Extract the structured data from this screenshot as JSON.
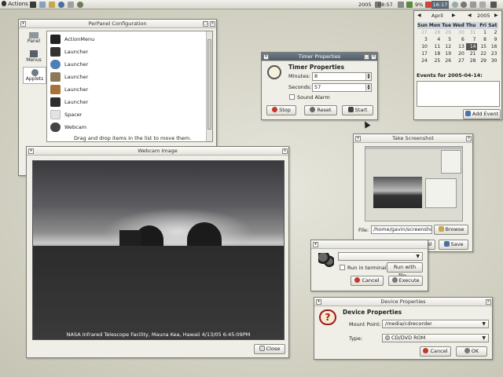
{
  "panel": {
    "menu_label": "Actions",
    "year": "2005",
    "time_small": "08:57",
    "battery": "9%",
    "clock": "16:17"
  },
  "calendar": {
    "month": "April",
    "year": "2005",
    "weekdays": [
      "Sun",
      "Mon",
      "Tue",
      "Wed",
      "Thu",
      "Fri",
      "Sat"
    ],
    "weeks": [
      [
        "27",
        "28",
        "29",
        "30",
        "31",
        "1",
        "2"
      ],
      [
        "3",
        "4",
        "5",
        "6",
        "7",
        "8",
        "9"
      ],
      [
        "10",
        "11",
        "12",
        "13",
        "14",
        "15",
        "16"
      ],
      [
        "17",
        "18",
        "19",
        "20",
        "21",
        "22",
        "23"
      ],
      [
        "24",
        "25",
        "26",
        "27",
        "28",
        "29",
        "30"
      ]
    ],
    "selected_day": "14",
    "events_label": "Events for 2005-04-14:",
    "add_event": "Add Event"
  },
  "perpanel": {
    "title": "PerPanel Configuration",
    "side_tabs": [
      "Panel",
      "Menus",
      "Applets"
    ],
    "items": [
      "ActionMenu",
      "Launcher",
      "Launcher",
      "Launcher",
      "Launcher",
      "Launcher",
      "Spacer",
      "Webcam"
    ],
    "hint": "Drag and drop items in the list to move them."
  },
  "timer": {
    "title": "Timer Properties",
    "heading": "Timer Properties",
    "minutes_label": "Minutes:",
    "minutes_value": "8",
    "seconds_label": "Seconds:",
    "seconds_value": "57",
    "alarm_label": "Sound Alarm",
    "stop": "Stop",
    "reset": "Reset",
    "start": "Start"
  },
  "webcam": {
    "title": "Webcam Image",
    "caption": "NASA Infrared Telescope Facility, Mauna Kea, Hawaii 4/13/05 6:45:09PM",
    "close": "Close"
  },
  "screenshot": {
    "title": "Take Screenshot",
    "file_label": "File:",
    "file_value": "/home/gavin/screenshot.p",
    "browse": "Browse",
    "cancel": "Cancel",
    "save": "Save"
  },
  "run": {
    "terminal_label": "Run in terminal",
    "run_with_file": "Run with file...",
    "cancel": "Cancel",
    "execute": "Execute"
  },
  "device": {
    "title": "Device Properties",
    "heading": "Device Properties",
    "mount_label": "Mount Point:",
    "mount_value": "/media/cdrecorder",
    "type_label": "Type:",
    "type_value": "CD/DVD ROM",
    "cancel": "Cancel",
    "ok": "OK"
  }
}
